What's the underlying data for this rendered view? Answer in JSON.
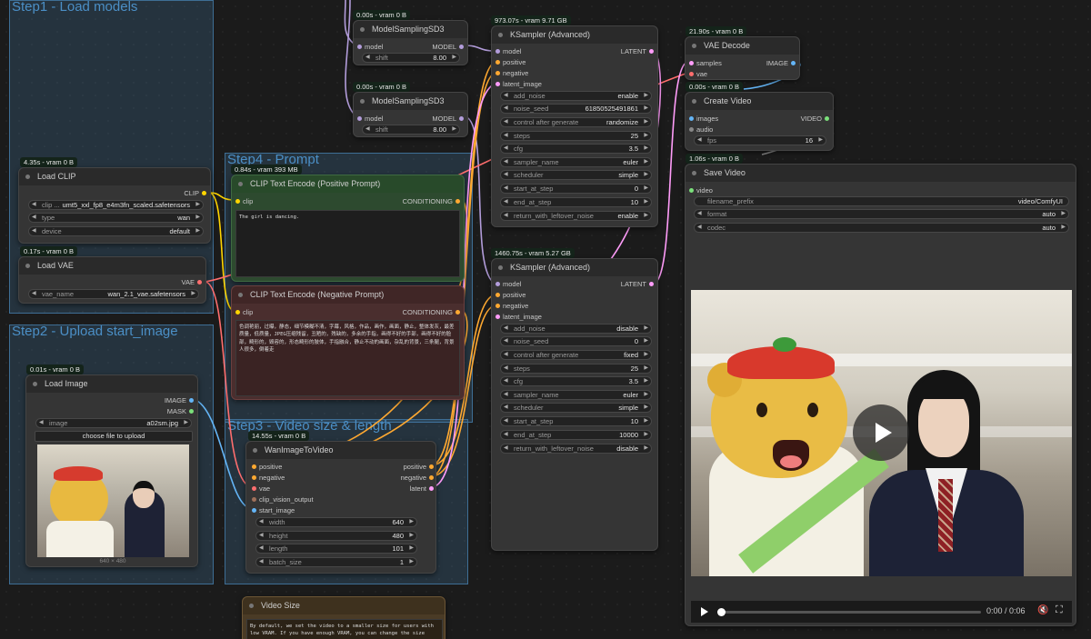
{
  "colors": {
    "clip": "#ffd500",
    "model": "#b39ddb",
    "latent": "#ff9cf9",
    "vae": "#ff6e6e",
    "image": "#64b5f6",
    "cond": "#ffa931",
    "video": "#7be07b"
  },
  "groups": {
    "step1": "Step1 - Load models",
    "step2": "Step2 - Upload start_image",
    "step4": "Step4 - Prompt",
    "step3": "Step3 - Video size & length"
  },
  "load_clip": {
    "badge": "4.35s - vram 0 B",
    "title": "Load CLIP",
    "out": "CLIP",
    "clip_label": "clip ...",
    "clip_value": "umt5_xxl_fp8_e4m3fn_scaled.safetensors",
    "type_label": "type",
    "type_value": "wan",
    "device_label": "device",
    "device_value": "default"
  },
  "load_vae": {
    "badge": "0.17s - vram 0 B",
    "title": "Load VAE",
    "out": "VAE",
    "name_label": "vae_name",
    "name_value": "wan_2.1_vae.safetensors"
  },
  "load_image": {
    "badge": "0.01s - vram 0 B",
    "title": "Load Image",
    "out1": "IMAGE",
    "out2": "MASK",
    "image_label": "image",
    "image_value": "a02sm.jpg",
    "upload": "choose file to upload",
    "dims": "640 × 480"
  },
  "ms1": {
    "badge": "0.00s - vram 0 B",
    "title": "ModelSamplingSD3",
    "in": "model",
    "out": "MODEL",
    "shift_label": "shift",
    "shift_value": "8.00"
  },
  "ms2": {
    "badge": "0.00s - vram 0 B",
    "title": "ModelSamplingSD3",
    "in": "model",
    "out": "MODEL",
    "shift_label": "shift",
    "shift_value": "8.00"
  },
  "pos": {
    "badge": "0.84s - vram 393 MB",
    "title": "CLIP Text Encode (Positive Prompt)",
    "in": "clip",
    "out": "CONDITIONING",
    "text": "The girl is dancing."
  },
  "neg": {
    "title": "CLIP Text Encode (Negative Prompt)",
    "in": "clip",
    "out": "CONDITIONING",
    "text": "色调艳丽，过曝，静态，细节模糊不清，字幕，风格，作品，画作，画面，静止，整体发灰，最差质量，低质量，JPEG压缩残留，丑陋的，残缺的，多余的手指，画得不好的手部，画得不好的脸部，畸形的，毁容的，形态畸形的肢体，手指融合，静止不动的画面，杂乱的背景，三条腿，背景人很多，倒着走"
  },
  "wan": {
    "badge": "14.55s - vram 0 B",
    "title": "WanImageToVideo",
    "in": [
      "positive",
      "negative",
      "vae",
      "clip_vision_output",
      "start_image"
    ],
    "out": [
      "positive",
      "negative",
      "latent"
    ],
    "widgets": [
      [
        "width",
        "640"
      ],
      [
        "height",
        "480"
      ],
      [
        "length",
        "101"
      ],
      [
        "batch_size",
        "1"
      ]
    ]
  },
  "ks1": {
    "badge": "973.07s - vram 9.71 GB",
    "title": "KSampler (Advanced)",
    "in": [
      "model",
      "positive",
      "negative",
      "latent_image"
    ],
    "out": "LATENT",
    "widgets": [
      [
        "add_noise",
        "enable"
      ],
      [
        "noise_seed",
        "61850525491861"
      ],
      [
        "control after generate",
        "randomize"
      ],
      [
        "steps",
        "25"
      ],
      [
        "cfg",
        "3.5"
      ],
      [
        "sampler_name",
        "euler"
      ],
      [
        "scheduler",
        "simple"
      ],
      [
        "start_at_step",
        "0"
      ],
      [
        "end_at_step",
        "10"
      ],
      [
        "return_with_leftover_noise",
        "enable"
      ]
    ]
  },
  "ks2": {
    "badge": "1460.75s - vram 5.27 GB",
    "title": "KSampler (Advanced)",
    "in": [
      "model",
      "positive",
      "negative",
      "latent_image"
    ],
    "out": "LATENT",
    "widgets": [
      [
        "add_noise",
        "disable"
      ],
      [
        "noise_seed",
        "0"
      ],
      [
        "control after generate",
        "fixed"
      ],
      [
        "steps",
        "25"
      ],
      [
        "cfg",
        "3.5"
      ],
      [
        "sampler_name",
        "euler"
      ],
      [
        "scheduler",
        "simple"
      ],
      [
        "start_at_step",
        "10"
      ],
      [
        "end_at_step",
        "10000"
      ],
      [
        "return_with_leftover_noise",
        "disable"
      ]
    ]
  },
  "vae_decode": {
    "badge": "21.90s - vram 0 B",
    "title": "VAE Decode",
    "in": [
      "samples",
      "vae"
    ],
    "out": "IMAGE"
  },
  "create_video": {
    "badge": "0.00s - vram 0 B",
    "title": "Create Video",
    "in": [
      "images",
      "audio"
    ],
    "out": "VIDEO",
    "fps_label": "fps",
    "fps_value": "16"
  },
  "save_video": {
    "badge": "1.06s - vram 0 B",
    "title": "Save Video",
    "in": "video",
    "widgets": [
      [
        "filename_prefix",
        "video/ComfyUI"
      ],
      [
        "format",
        "auto"
      ],
      [
        "codec",
        "auto"
      ]
    ],
    "time": "0:00 / 0:06"
  },
  "video_size": {
    "title": "Video Size",
    "text": "By default, we set the video to a smaller size for users with low VRAM. If you have enough VRAM, you can change the size"
  }
}
